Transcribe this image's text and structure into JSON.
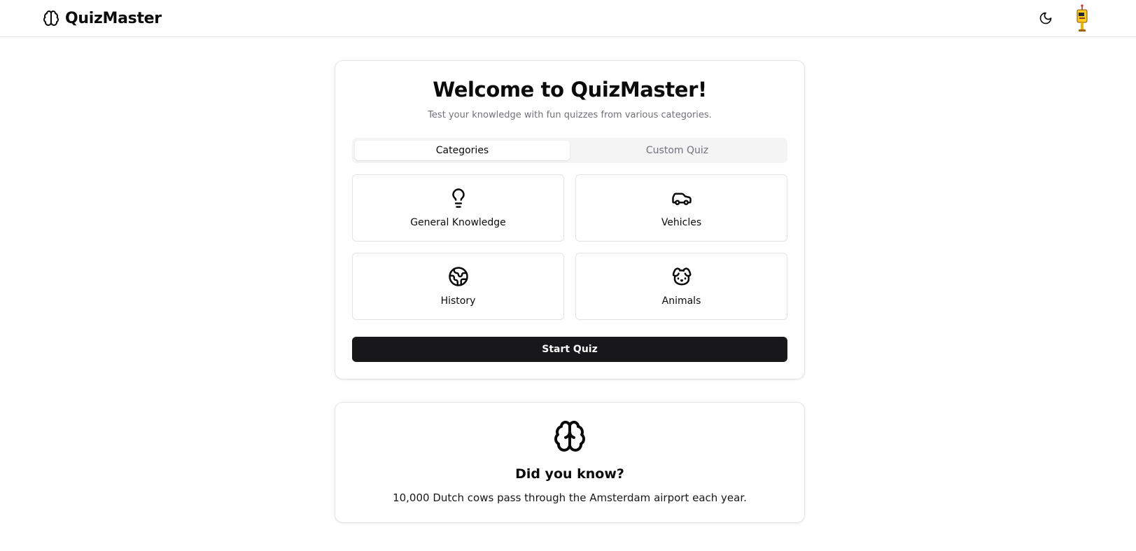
{
  "header": {
    "brand": "QuizMaster",
    "brand_icon": "brain-icon",
    "theme_icon": "moon-icon",
    "avatar_icon": "avatar-icon"
  },
  "welcome": {
    "title": "Welcome to QuizMaster!",
    "subtitle": "Test your knowledge with fun quizzes from various categories."
  },
  "tabs": [
    {
      "label": "Categories",
      "active": true
    },
    {
      "label": "Custom Quiz",
      "active": false
    }
  ],
  "categories": [
    {
      "label": "General Knowledge",
      "icon": "lightbulb-icon"
    },
    {
      "label": "Vehicles",
      "icon": "car-icon"
    },
    {
      "label": "History",
      "icon": "globe-icon"
    },
    {
      "label": "Animals",
      "icon": "dog-icon"
    }
  ],
  "start_button": "Start Quiz",
  "fact": {
    "icon": "brain-icon",
    "title": "Did you know?",
    "text": "10,000 Dutch cows pass through the Amsterdam airport each year."
  },
  "colors": {
    "primary": "#18181b",
    "muted_text": "#71717a",
    "border": "#e4e4e7",
    "tab_bg": "#f4f4f5"
  }
}
